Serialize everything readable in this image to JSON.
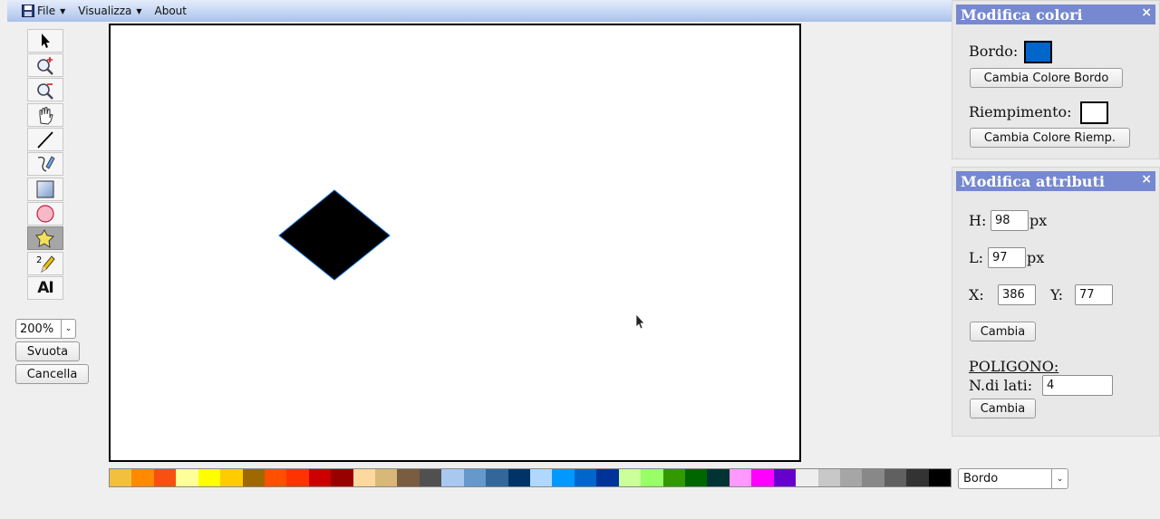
{
  "menu": {
    "file": "File",
    "view": "Visualizza",
    "about": "About"
  },
  "toolbar": {
    "tools": [
      "select-tool",
      "zoom-in-tool",
      "zoom-out-tool",
      "pan-tool",
      "line-tool",
      "freehand-tool",
      "rectangle-tool",
      "ellipse-tool",
      "polygon-tool",
      "pencil-tool",
      "text-tool"
    ],
    "active_tool": "polygon-tool",
    "text_tool_glyph": "AI",
    "zoom_value": "200%",
    "svuota_label": "Svuota",
    "cancella_label": "Cancella"
  },
  "canvas": {
    "shape": "polygon",
    "sides": 4,
    "fill_color": "#000000",
    "stroke_color": "#0066cc"
  },
  "palette": {
    "colors": [
      "#f2c03c",
      "#ff8a00",
      "#f75010",
      "#ffff99",
      "#ffff00",
      "#ffcc00",
      "#a06800",
      "#ff5000",
      "#ff3300",
      "#cc0000",
      "#990000",
      "#ffd8a0",
      "#d8b878",
      "#7a5c40",
      "#505050",
      "#a8c8f0",
      "#6698cc",
      "#336699",
      "#003366",
      "#b0d8ff",
      "#0099ff",
      "#0066cc",
      "#003399",
      "#ccff99",
      "#99ff66",
      "#339900",
      "#006600",
      "#003333",
      "#ff99ff",
      "#ff00ff",
      "#6600cc",
      "#eeeeee",
      "#c8c8c8",
      "#a6a6a6",
      "#888888",
      "#606060",
      "#333333",
      "#000000"
    ],
    "target_select": "Bordo"
  },
  "colors_panel": {
    "title": "Modifica colori",
    "close": "×",
    "border_label": "Bordo:",
    "border_color": "#0066cc",
    "change_border_button": "Cambia Colore Bordo",
    "fill_label": "Riempimento:",
    "fill_color": "#ffffff",
    "change_fill_button": "Cambia Colore Riemp."
  },
  "attributes_panel": {
    "title": "Modifica attributi",
    "close": "×",
    "h_label": "H:",
    "h_value": "98",
    "l_label": "L:",
    "l_value": "97",
    "unit": "px",
    "x_label": "X:",
    "x_value": "386",
    "y_label": "Y:",
    "y_value": "77",
    "change_button": "Cambia",
    "polygon_heading": "POLIGONO:",
    "sides_label": "N.di lati:",
    "sides_value": "4",
    "sides_change_button": "Cambia"
  }
}
